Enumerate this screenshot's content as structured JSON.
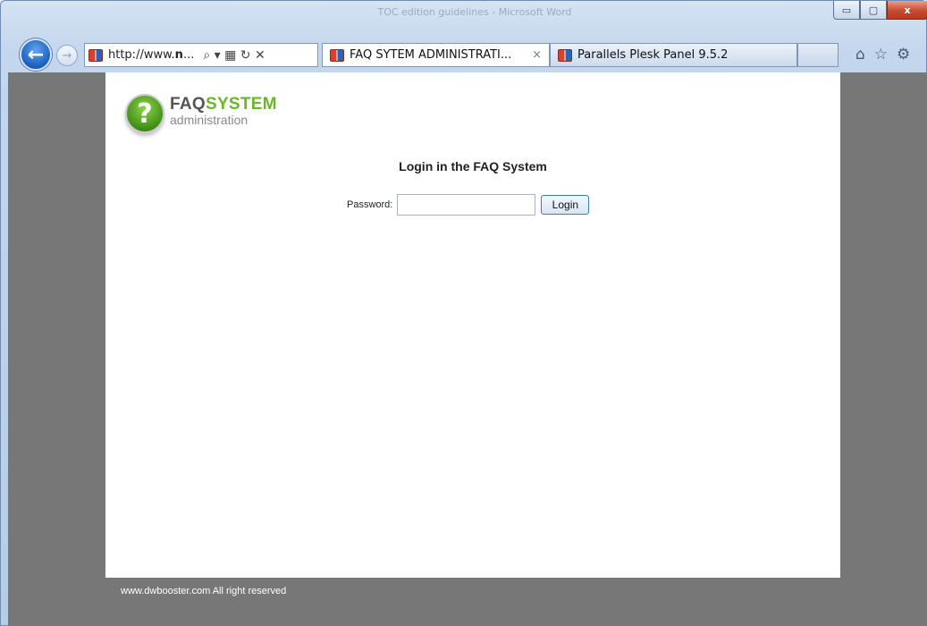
{
  "window": {
    "title": "TOC edition guidelines - Microsoft Word",
    "controls": {
      "minimize": "▭",
      "maximize": "▢",
      "close": "x"
    }
  },
  "nav": {
    "back_icon": "←",
    "forward_icon": "→",
    "address": {
      "prefix": "http://www.",
      "bold": "n",
      "suffix": "...",
      "tools": "⌕ ▾ ▦ ↻ ✕"
    },
    "right_tools": [
      "⌂",
      "☆",
      "⚙"
    ]
  },
  "tabs": [
    {
      "label": "FAQ SYTEM ADMINISTRATI...",
      "close": "×",
      "active": true
    },
    {
      "label": "Parallels Plesk Panel 9.5.2",
      "active": false
    }
  ],
  "page": {
    "logo": {
      "mark": "?",
      "faq": "FAQ",
      "system": "SYSTEM",
      "sub": "administration"
    },
    "heading": "Login in the FAQ System",
    "password_label": "Password:",
    "password_value": "",
    "login_button": "Login",
    "footer": "www.dwbooster.com All right reserved"
  },
  "colors": {
    "content_bg": "#777777",
    "page_bg": "#ffffff",
    "accent_green": "#6cb62b"
  }
}
